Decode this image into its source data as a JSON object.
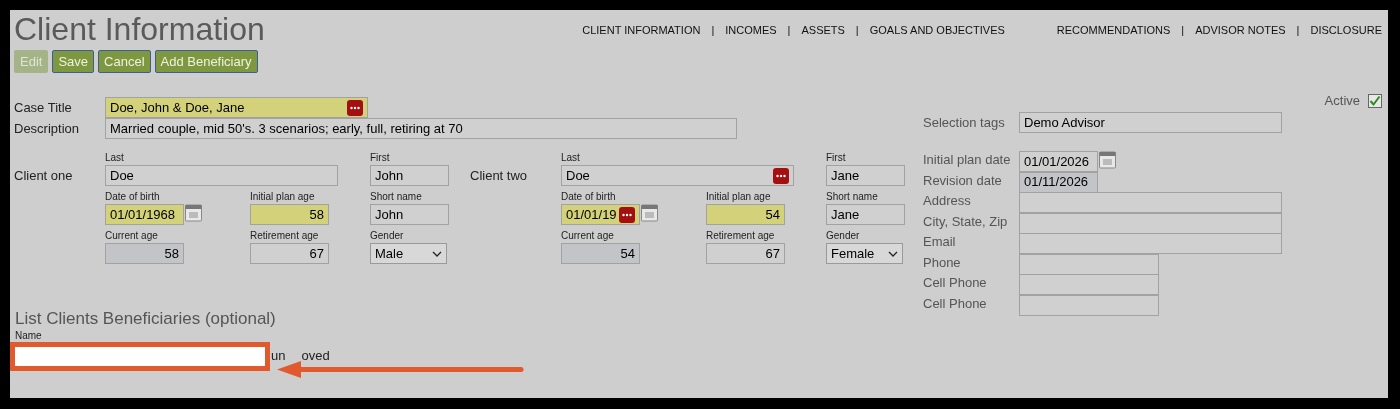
{
  "title": "Client Information",
  "nav": [
    {
      "kind": "link",
      "label": "CLIENT INFORMATION"
    },
    {
      "kind": "separator",
      "label": "|"
    },
    {
      "kind": "link",
      "label": "INCOMES"
    },
    {
      "kind": "separator",
      "label": "|"
    },
    {
      "kind": "link",
      "label": "ASSETS"
    },
    {
      "kind": "separator",
      "label": "|"
    },
    {
      "kind": "link",
      "label": "GOALS AND OBJECTIVES"
    },
    {
      "kind": "gap"
    },
    {
      "kind": "link",
      "label": "RECOMMENDATIONS"
    },
    {
      "kind": "separator",
      "label": "|"
    },
    {
      "kind": "link",
      "label": "ADVISOR NOTES"
    },
    {
      "kind": "separator",
      "label": "|"
    },
    {
      "kind": "link",
      "label": "DISCLOSURE"
    }
  ],
  "buttons": [
    {
      "label": "Edit",
      "disabled": true
    },
    {
      "label": "Save",
      "disabled": false
    },
    {
      "label": "Cancel",
      "disabled": false
    },
    {
      "label": "Add Beneficiary",
      "disabled": false
    }
  ],
  "case_title": {
    "label": "Case Title",
    "value": "Doe, John & Doe, Jane",
    "required": true,
    "readonly": false,
    "numeric": false,
    "lookup": true
  },
  "description": {
    "label": "Description",
    "value": "Married couple, mid 50's. 3 scenarios; early, full, retiring at 70",
    "required": false,
    "readonly": false,
    "numeric": false,
    "lookup": false
  },
  "active": {
    "label": "Active",
    "checked": true
  },
  "selection_tags": {
    "label": "Selection tags",
    "value": "Demo Advisor",
    "required": false,
    "readonly": false,
    "numeric": false,
    "lookup": false
  },
  "clients": [
    {
      "label": "Client one",
      "fields": [
        {
          "kind": "text",
          "label": "Last",
          "value": "Doe",
          "required": false,
          "readonly": false,
          "numeric": false,
          "lookup": false
        },
        {
          "kind": "text",
          "label": "First",
          "value": "John",
          "required": false,
          "readonly": false,
          "numeric": false,
          "lookup": false
        },
        {
          "kind": "text",
          "label": "Date of birth",
          "value": "01/01/1968",
          "required": true,
          "readonly": false,
          "numeric": false,
          "lookup": false,
          "calendar": true
        },
        {
          "kind": "text",
          "label": "Initial plan age",
          "value": "58",
          "required": true,
          "readonly": false,
          "numeric": true,
          "lookup": false
        },
        {
          "kind": "text",
          "label": "Short name",
          "value": "John",
          "required": false,
          "readonly": false,
          "numeric": false,
          "lookup": false
        },
        {
          "kind": "text",
          "label": "Current age",
          "value": "58",
          "required": false,
          "readonly": true,
          "numeric": true,
          "lookup": false
        },
        {
          "kind": "text",
          "label": "Retirement age",
          "value": "67",
          "required": false,
          "readonly": false,
          "numeric": true,
          "lookup": false
        },
        {
          "kind": "select",
          "label": "Gender",
          "value": "Male"
        }
      ]
    },
    {
      "label": "Client two",
      "fields": [
        {
          "kind": "text",
          "label": "Last",
          "value": "Doe",
          "required": false,
          "readonly": false,
          "numeric": false,
          "lookup": true
        },
        {
          "kind": "text",
          "label": "First",
          "value": "Jane",
          "required": false,
          "readonly": false,
          "numeric": false,
          "lookup": false
        },
        {
          "kind": "text",
          "label": "Date of birth",
          "value": "01/01/19",
          "required": true,
          "readonly": false,
          "numeric": false,
          "lookup": true,
          "calendar": true
        },
        {
          "kind": "text",
          "label": "Initial plan age",
          "value": "54",
          "required": true,
          "readonly": false,
          "numeric": true,
          "lookup": false
        },
        {
          "kind": "text",
          "label": "Short name",
          "value": "Jane",
          "required": false,
          "readonly": false,
          "numeric": false,
          "lookup": false
        },
        {
          "kind": "text",
          "label": "Current age",
          "value": "54",
          "required": false,
          "readonly": true,
          "numeric": true,
          "lookup": false
        },
        {
          "kind": "text",
          "label": "Retirement age",
          "value": "67",
          "required": false,
          "readonly": false,
          "numeric": true,
          "lookup": false
        },
        {
          "kind": "select",
          "label": "Gender",
          "value": "Female"
        }
      ]
    }
  ],
  "contact": [
    {
      "label": "Initial plan date",
      "value": "01/01/2026",
      "kind": "date",
      "required": false,
      "readonly": false,
      "numeric": false,
      "lookup": false,
      "calendar": true
    },
    {
      "label": "Revision date",
      "value": "01/11/2026",
      "kind": "date",
      "required": false,
      "readonly": true,
      "numeric": false,
      "lookup": false
    },
    {
      "label": "Address",
      "kind": "wide",
      "required": false,
      "readonly": false,
      "lookup": false
    },
    {
      "label": "City, State, Zip",
      "kind": "wide",
      "required": false,
      "readonly": false,
      "lookup": false
    },
    {
      "label": "Email",
      "kind": "wide",
      "required": false,
      "readonly": false,
      "lookup": false
    },
    {
      "label": "Phone",
      "kind": "narrow",
      "required": false,
      "readonly": false,
      "lookup": false
    },
    {
      "label": "Cell Phone",
      "kind": "narrow",
      "required": false,
      "readonly": false,
      "lookup": false
    },
    {
      "label": "Cell Phone",
      "kind": "narrow",
      "required": false,
      "readonly": false,
      "lookup": false
    }
  ],
  "beneficiaries": {
    "heading": "List Clients Beneficiaries (optional)",
    "name_label": "Name",
    "hidden_text": [
      "un",
      "oved"
    ]
  }
}
